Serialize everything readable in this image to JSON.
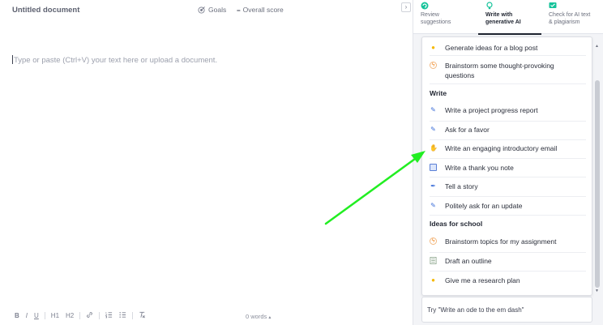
{
  "editor": {
    "title": "Untitled document",
    "goals_label": "Goals",
    "score_dash": "--",
    "score_label": "Overall score",
    "placeholder": "Type or paste (Ctrl+V) your text here or upload a document.",
    "word_count": "0 words"
  },
  "toolbar": {
    "bold": "B",
    "italic": "I",
    "underline": "U",
    "h1": "H1",
    "h2": "H2",
    "link_icon": "link-icon",
    "ordered_list_icon": "ordered-list-icon",
    "bullet_list_icon": "bullet-list-icon",
    "clear_format_icon": "clear-format-icon"
  },
  "panel": {
    "tabs": [
      {
        "label_line1": "Review",
        "label_line2": "suggestions",
        "icon": "review-icon",
        "active": false
      },
      {
        "label_line1": "Write with",
        "label_line2": "generative AI",
        "icon": "bulb-icon",
        "active": true
      },
      {
        "label_line1": "Check for AI text",
        "label_line2": "& plagiarism",
        "icon": "check-icon",
        "active": false
      }
    ],
    "groups": {
      "ideas": [
        {
          "label": "Generate ideas for a blog post",
          "icon": "lightbulb-icon"
        },
        {
          "label": "Brainstorm some thought-provoking questions",
          "icon": "lightning-icon"
        }
      ],
      "write_heading": "Write",
      "write": [
        {
          "label": "Write a project progress report",
          "icon": "pencil-icon"
        },
        {
          "label": "Ask for a favor",
          "icon": "pencil-icon"
        },
        {
          "label": "Write an engaging introductory email",
          "icon": "wave-hand-icon"
        },
        {
          "label": "Write a thank you note",
          "icon": "card-icon"
        },
        {
          "label": "Tell a story",
          "icon": "feather-icon"
        },
        {
          "label": "Politely ask for an update",
          "icon": "pencil-icon"
        }
      ],
      "school_heading": "Ideas for school",
      "school": [
        {
          "label": "Brainstorm topics for my assignment",
          "icon": "lightning-icon"
        },
        {
          "label": "Draft an outline",
          "icon": "outline-icon"
        },
        {
          "label": "Give me a research plan",
          "icon": "lightbulb-icon"
        }
      ]
    },
    "prompt_placeholder": "Try \"Write an ode to the em dash\""
  },
  "colors": {
    "accent": "#15c39a",
    "arrow": "#22ee22",
    "panel_bg": "#f3f4f7"
  }
}
